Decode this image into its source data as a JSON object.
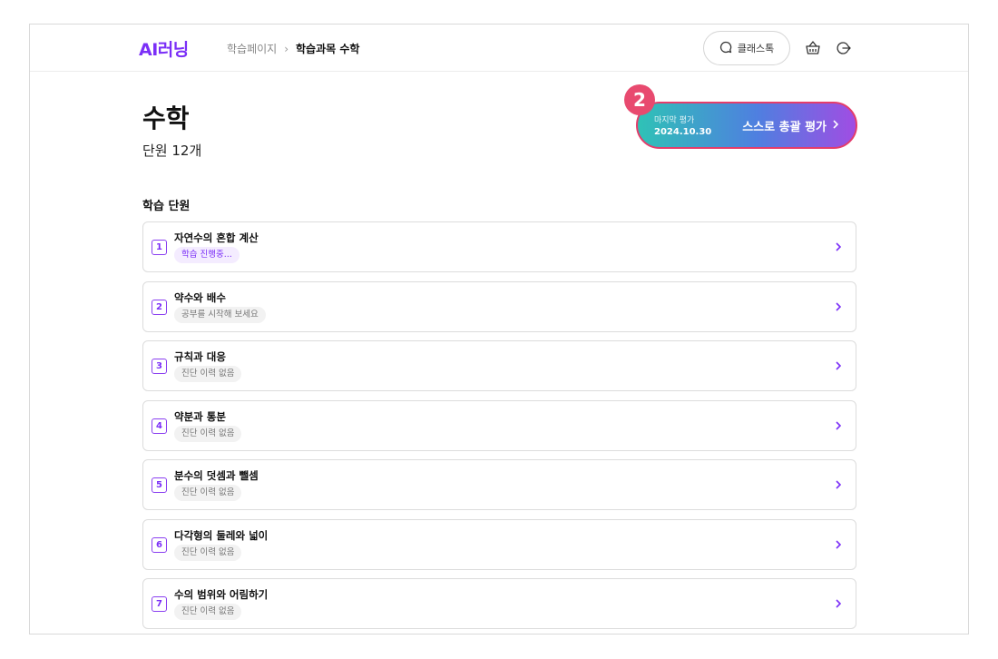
{
  "header": {
    "logo": "AI러닝",
    "breadcrumb": {
      "parent": "학습페이지",
      "separator": "›",
      "current": "학습과목 수학"
    },
    "classtalk_label": "클래스톡",
    "icons": [
      "chat-bubble-icon",
      "basket-icon",
      "logout-icon"
    ]
  },
  "page": {
    "title": "수학",
    "unit_count": "단원 12개"
  },
  "evaluation": {
    "badge": "2",
    "last_label": "마지막 평가",
    "last_date": "2024.10.30",
    "action_label": "스스로 총괄 평가"
  },
  "units_section": {
    "title": "학습 단원",
    "units": [
      {
        "number": "1",
        "name": "자연수의 혼합 계산",
        "status": "학습 진행중...",
        "active": true
      },
      {
        "number": "2",
        "name": "약수와 배수",
        "status": "공부를 시작해 보세요",
        "active": false
      },
      {
        "number": "3",
        "name": "규칙과 대응",
        "status": "진단 이력 없음",
        "active": false
      },
      {
        "number": "4",
        "name": "약분과 통분",
        "status": "진단 이력 없음",
        "active": false
      },
      {
        "number": "5",
        "name": "분수의 덧셈과 뺄셈",
        "status": "진단 이력 없음",
        "active": false
      },
      {
        "number": "6",
        "name": "다각형의 둘레와 넓이",
        "status": "진단 이력 없음",
        "active": false
      },
      {
        "number": "7",
        "name": "수의 범위와 어림하기",
        "status": "진단 이력 없음",
        "active": false
      }
    ]
  },
  "colors": {
    "brand": "#7b2ff7",
    "badge": "#e84a6f",
    "eval_border": "#e43d6b"
  }
}
